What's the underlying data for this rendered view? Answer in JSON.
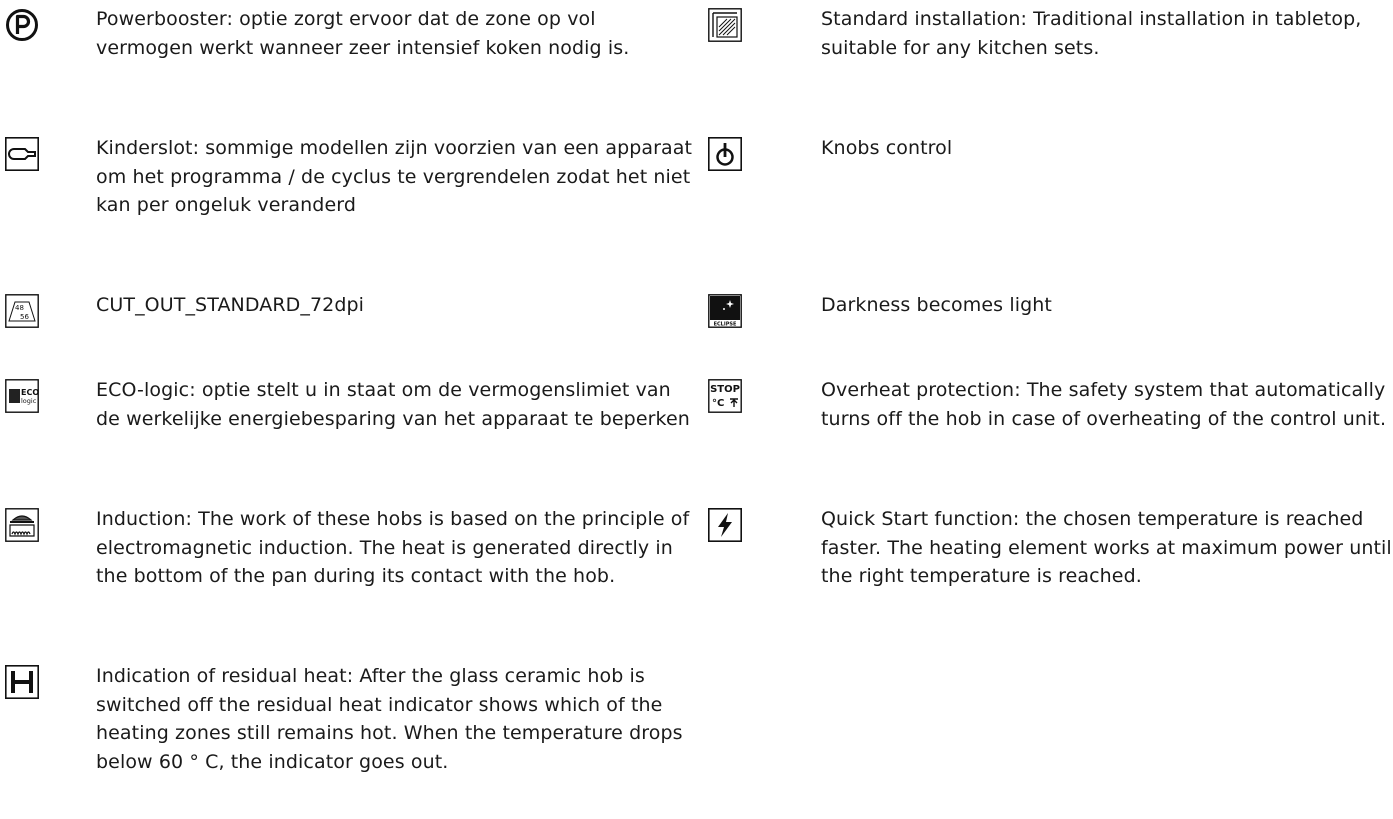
{
  "features_left": [
    {
      "icon": "powerbooster-icon",
      "text": "Powerbooster: optie zorgt ervoor dat de zone op vol vermogen werkt wanneer zeer intensief koken nodig is."
    },
    {
      "icon": "child-lock-icon",
      "text": "Kinderslot: sommige modellen zijn voorzien van een apparaat om het programma / de cyclus te vergrendelen zodat het niet kan per ongeluk veranderd"
    },
    {
      "icon": "cut-out-standard-icon",
      "icon_text_top": "48",
      "icon_text_bottom": "56",
      "text": "CUT_OUT_STANDARD_72dpi"
    },
    {
      "icon": "eco-logic-icon",
      "icon_text_top": "ECO",
      "icon_text_bottom": "logic",
      "text": "ECO-logic: optie stelt u in staat om de vermogenslimiet van de werkelijke energiebesparing van het apparaat te beperken"
    },
    {
      "icon": "induction-icon",
      "text": "Induction: The work of these hobs is based on the principle of electromagnetic induction. The heat is generated directly in the bottom of the pan during its contact with the hob."
    },
    {
      "icon": "residual-heat-icon",
      "text": "Indication of residual heat: After the glass ceramic hob is switched off the residual heat indicator shows which of the heating zones still remains hot. When the temperature drops below 60 ° C, the indicator goes out."
    }
  ],
  "features_right": [
    {
      "icon": "standard-installation-icon",
      "text": "Standard installation: Traditional installation in tabletop, suitable for any kitchen sets."
    },
    {
      "icon": "knob-icon",
      "text": "Knobs control"
    },
    {
      "icon": "eclipse-icon",
      "icon_text": "ECLIPSE",
      "text": "Darkness becomes light"
    },
    {
      "icon": "overheat-stop-icon",
      "icon_text_top": "STOP",
      "icon_text_bottom": "°C",
      "text": "Overheat protection: The safety system that automatically turns off the hob in case of overheating of the control unit."
    },
    {
      "icon": "quick-start-icon",
      "text": "Quick Start function: the chosen temperature is reached faster. The heating element works at maximum power until the right temperature is reached."
    }
  ]
}
